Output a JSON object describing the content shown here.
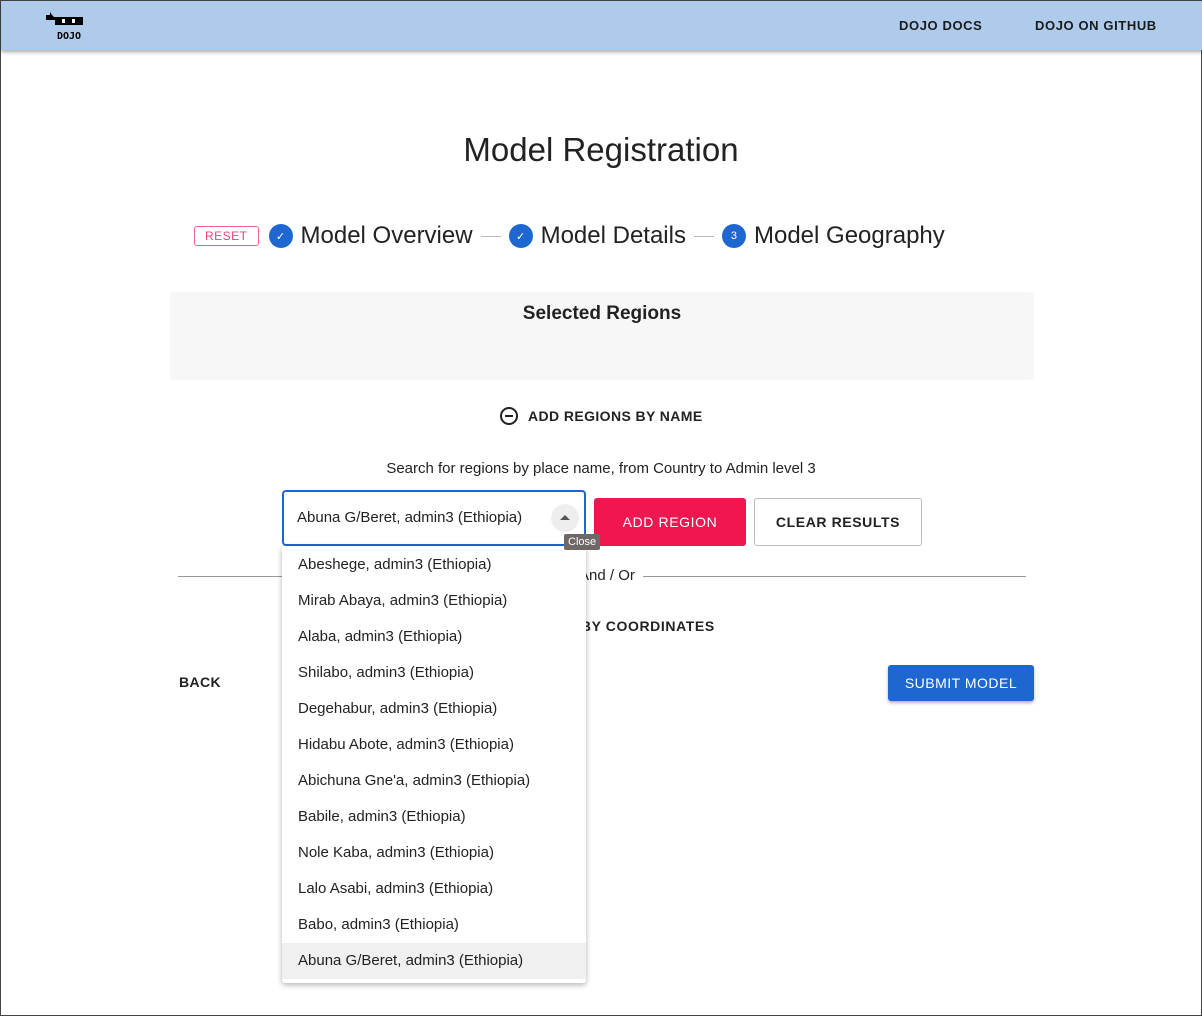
{
  "appbar": {
    "logo_text": "DOJO",
    "links": [
      "DOJO DOCS",
      "DOJO ON GITHUB"
    ]
  },
  "page_title": "Model Registration",
  "stepper": {
    "reset_label": "RESET",
    "steps": [
      {
        "label": "Model Overview",
        "state": "complete"
      },
      {
        "label": "Model Details",
        "state": "complete"
      },
      {
        "label": "Model Geography",
        "state": "active",
        "number": "3"
      }
    ]
  },
  "selected_regions": {
    "title": "Selected Regions"
  },
  "add_by_name": {
    "label": "ADD REGIONS BY NAME"
  },
  "search": {
    "hint": "Search for regions by place name, from Country to Admin level 3",
    "value": "Abuna G/Beret, admin3 (Ethiopia)",
    "tooltip": "Close",
    "options": [
      "Abeshege, admin3 (Ethiopia)",
      "Mirab Abaya, admin3 (Ethiopia)",
      "Alaba, admin3 (Ethiopia)",
      "Shilabo, admin3 (Ethiopia)",
      "Degehabur, admin3 (Ethiopia)",
      "Hidabu Abote, admin3 (Ethiopia)",
      "Abichuna Gne'a, admin3 (Ethiopia)",
      "Babile, admin3 (Ethiopia)",
      "Nole Kaba, admin3 (Ethiopia)",
      "Lalo Asabi, admin3 (Ethiopia)",
      "Babo, admin3 (Ethiopia)",
      "Abuna G/Beret, admin3 (Ethiopia)"
    ],
    "highlighted_index": 11
  },
  "buttons": {
    "add_region": "ADD REGION",
    "clear_results": "CLEAR RESULTS",
    "back": "BACK",
    "submit": "SUBMIT MODEL"
  },
  "divider_text": "And / Or",
  "add_by_coords": {
    "label": "ADD REGIONS BY COORDINATES"
  },
  "colors": {
    "appbar": "#aecbec",
    "primary": "#1e66d0",
    "accent": "#f0164f"
  }
}
